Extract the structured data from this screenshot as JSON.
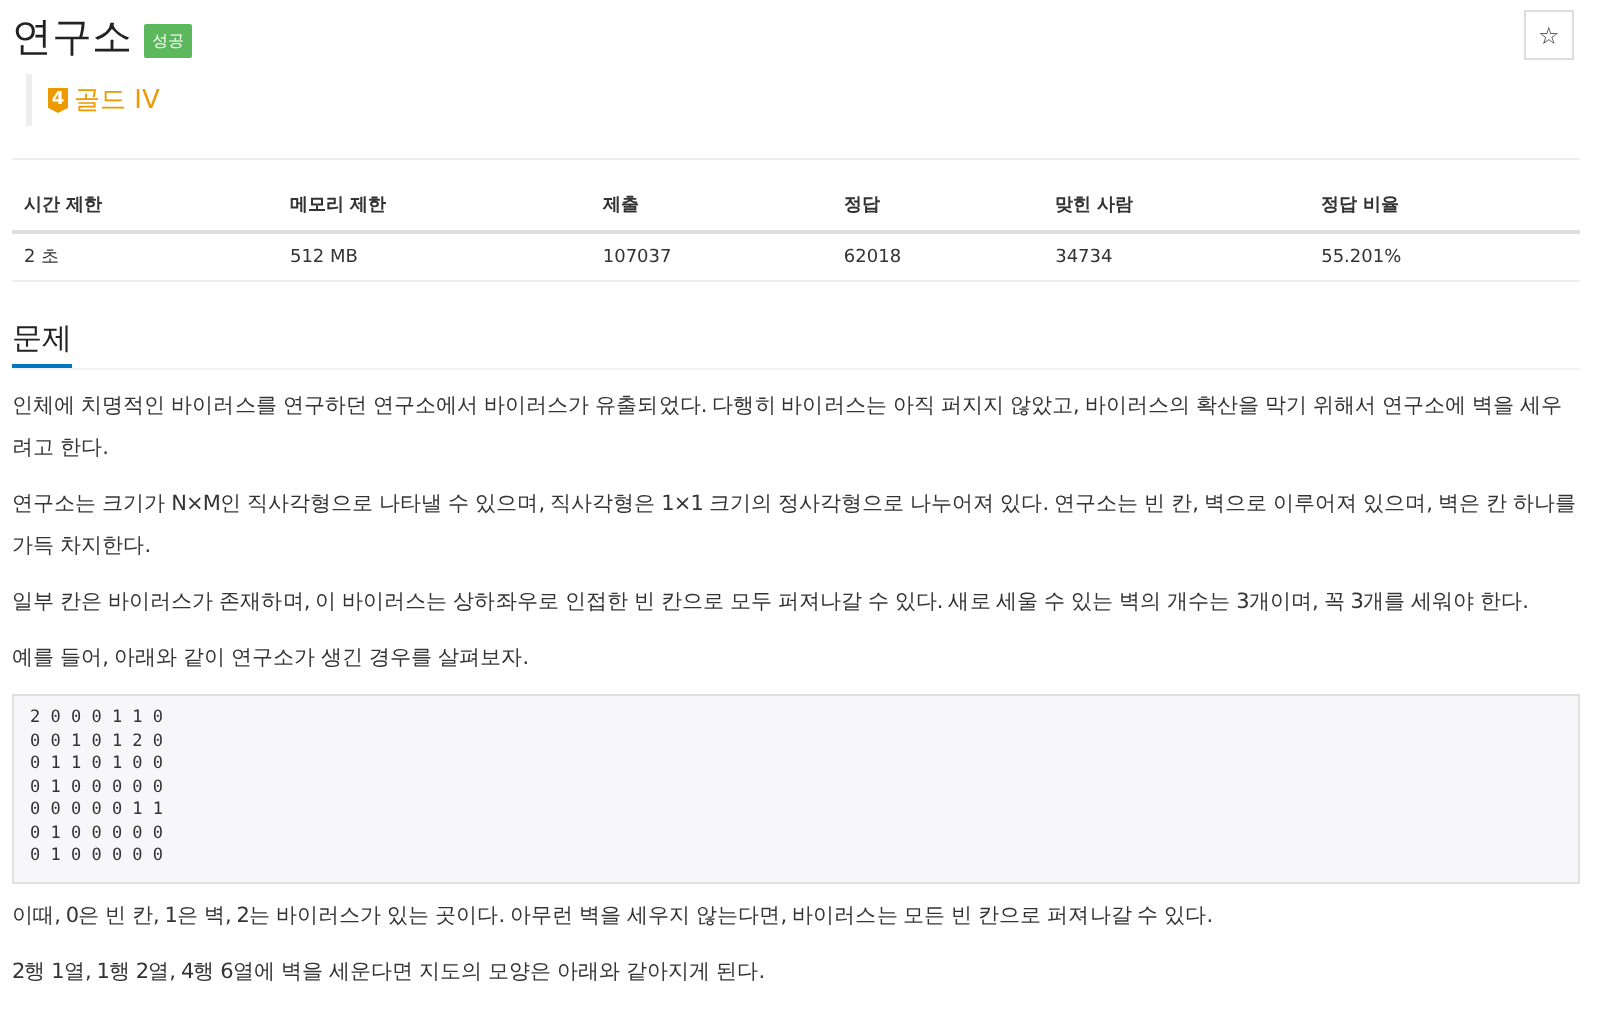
{
  "problem": {
    "title": "연구소",
    "result_badge": "성공",
    "favorite_button": "☆",
    "tier": {
      "level": "4",
      "label": "골드 IV"
    }
  },
  "info_table": {
    "columns": [
      "시간 제한",
      "메모리 제한",
      "제출",
      "정답",
      "맞힌 사람",
      "정답 비율"
    ],
    "rows": [
      [
        "2 초",
        "512 MB",
        "107037",
        "62018",
        "34734",
        "55.201%"
      ]
    ]
  },
  "section": {
    "title": "문제",
    "selected": true
  },
  "paragraphs_before": [
    "인체에 치명적인 바이러스를 연구하던 연구소에서 바이러스가 유출되었다. 다행히 바이러스는 아직 퍼지지 않았고, 바이러스의 확산을 막기 위해서 연구소에 벽을 세우려고 한다.",
    "연구소는 크기가 N×M인 직사각형으로 나타낼 수 있으며, 직사각형은 1×1 크기의 정사각형으로 나누어져 있다. 연구소는 빈 칸, 벽으로 이루어져 있으며, 벽은 칸 하나를 가득 차지한다.",
    "일부 칸은 바이러스가 존재하며, 이 바이러스는 상하좌우로 인접한 빈 칸으로 모두 퍼져나갈 수 있다. 새로 세울 수 있는 벽의 개수는 3개이며, 꼭 3개를 세워야 한다.",
    "예를 들어, 아래와 같이 연구소가 생긴 경우를 살펴보자."
  ],
  "code_lines": [
    "2 0 0 0 1 1 0",
    "0 0 1 0 1 2 0",
    "0 1 1 0 1 0 0",
    "0 1 0 0 0 0 0",
    "0 0 0 0 0 1 1",
    "0 1 0 0 0 0 0",
    "0 1 0 0 0 0 0"
  ],
  "paragraphs_after": [
    "이때, 0은 빈 칸, 1은 벽, 2는 바이러스가 있는 곳이다. 아무런 벽을 세우지 않는다면, 바이러스는 모든 빈 칸으로 퍼져나갈 수 있다.",
    "2행 1열, 1행 2열, 4행 6열에 벽을 세운다면 지도의 모양은 아래와 같아지게 된다."
  ]
}
